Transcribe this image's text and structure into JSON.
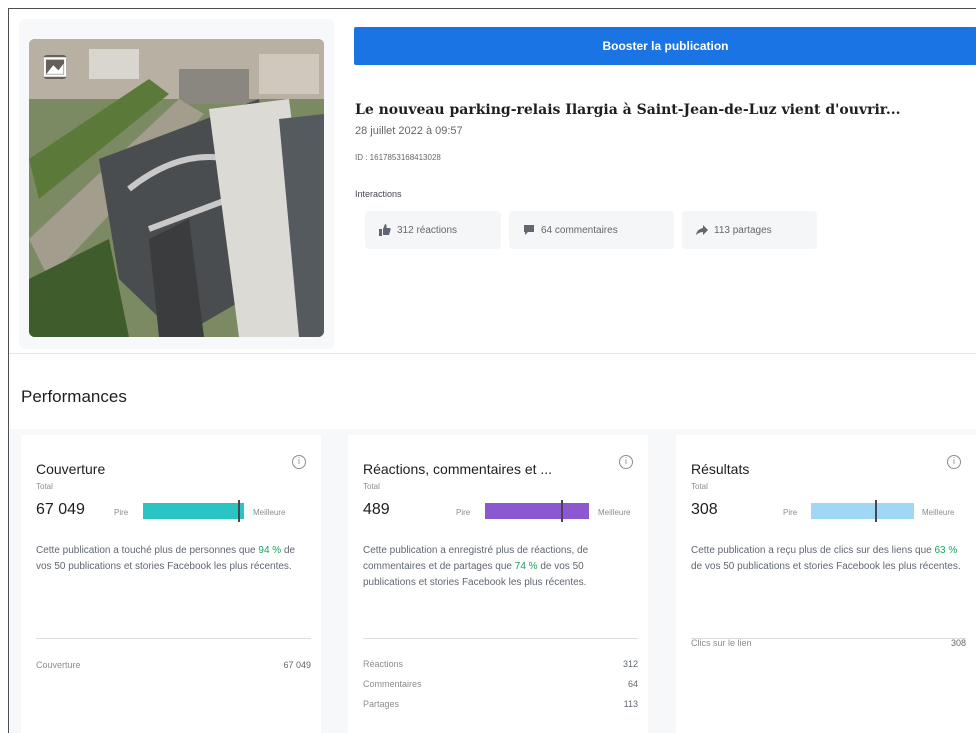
{
  "post": {
    "boost_label": "Booster la publication",
    "title": "Le nouveau parking-relais Ilargia à Saint-Jean-de-Luz vient d'ouvrir...",
    "date": "28 juillet 2022 à 09:57",
    "id_text": "ID : 1617853168413028",
    "interactions_label": "Interactions",
    "chips": {
      "reactions": "312 réactions",
      "comments": "64 commentaires",
      "shares": "113 partages"
    },
    "image_icon": "image-icon"
  },
  "performance": {
    "title": "Performances",
    "cards": [
      {
        "title": "Couverture",
        "total_label": "Total",
        "total": "67 049",
        "low": "Pire",
        "high": "Meilleure",
        "bar_color": "#2bc4c4",
        "marker_position": 0.95,
        "desc_before": "Cette publication a touché plus de personnes que ",
        "pct": "94 %",
        "desc_after": " de vos 50 publications et stories Facebook les plus récentes.",
        "rows": [
          {
            "label": "Couverture",
            "value": "67 049"
          }
        ]
      },
      {
        "title": "Réactions, commentaires et ...",
        "total_label": "Total",
        "total": "489",
        "low": "Pire",
        "high": "Meilleure",
        "bar_color": "#8b58d2",
        "marker_position": 0.74,
        "desc_before": "Cette publication a enregistré plus de réactions, de commentaires et de partages que ",
        "pct": "74 %",
        "desc_after": " de vos 50 publications et stories Facebook les plus récentes.",
        "rows": [
          {
            "label": "Réactions",
            "value": "312"
          },
          {
            "label": "Commentaires",
            "value": "64"
          },
          {
            "label": "Partages",
            "value": "113"
          }
        ]
      },
      {
        "title": "Résultats",
        "total_label": "Total",
        "total": "308",
        "low": "Pire",
        "high": "Meilleure",
        "bar_color": "#9fd8f6",
        "marker_position": 0.63,
        "desc_before": "Cette publication a reçu plus de clics sur des liens que ",
        "pct": "63 %",
        "desc_after": " de vos 50 publications et stories Facebook les plus récentes.",
        "rows": [
          {
            "label": "Clics sur le lien",
            "value": "308"
          }
        ]
      }
    ]
  }
}
